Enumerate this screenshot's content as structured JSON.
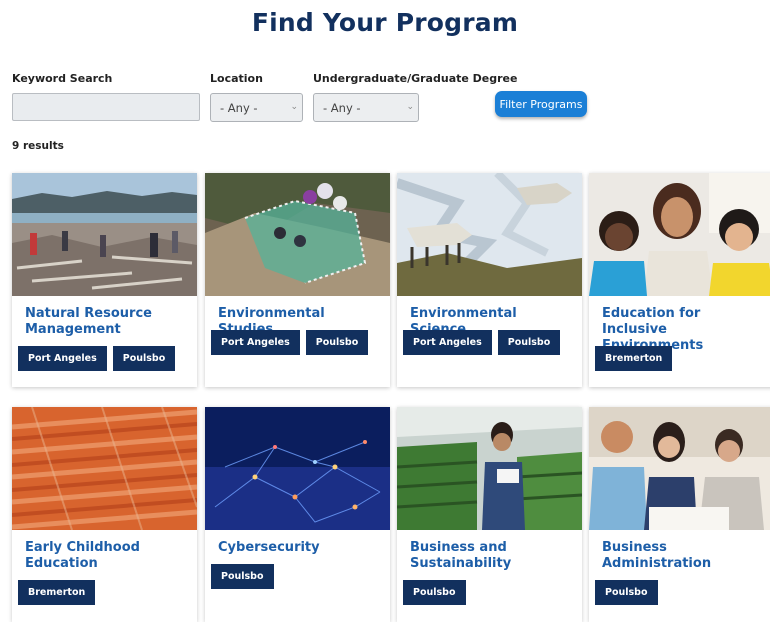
{
  "page": {
    "title": "Find Your Program"
  },
  "filters": {
    "keyword": {
      "label": "Keyword Search",
      "value": "",
      "placeholder": ""
    },
    "location": {
      "label": "Location",
      "selected": "- Any -"
    },
    "degree": {
      "label": "Undergraduate/Graduate Degree",
      "selected": "- Any -"
    },
    "submit_label": "Filter Programs"
  },
  "results": {
    "count_label": "9 results",
    "programs": [
      {
        "title": "Natural Resource Management",
        "locations": [
          "Port Angeles",
          "Poulsbo"
        ]
      },
      {
        "title": "Environmental Studies",
        "locations": [
          "Port Angeles",
          "Poulsbo"
        ]
      },
      {
        "title": "Environmental Science",
        "locations": [
          "Port Angeles",
          "Poulsbo"
        ]
      },
      {
        "title": "Education for Inclusive Environments",
        "locations": [
          "Bremerton"
        ]
      },
      {
        "title": "Early Childhood Education",
        "locations": [
          "Bremerton"
        ]
      },
      {
        "title": "Cybersecurity",
        "locations": [
          "Poulsbo"
        ]
      },
      {
        "title": "Business and Sustainability",
        "locations": [
          "Poulsbo"
        ]
      },
      {
        "title": "Business Administration",
        "locations": [
          "Poulsbo"
        ]
      }
    ]
  },
  "colors": {
    "title": "#12305e",
    "tag": "#12305e",
    "link": "#1d5ea8",
    "button": "#1b7fd6"
  }
}
